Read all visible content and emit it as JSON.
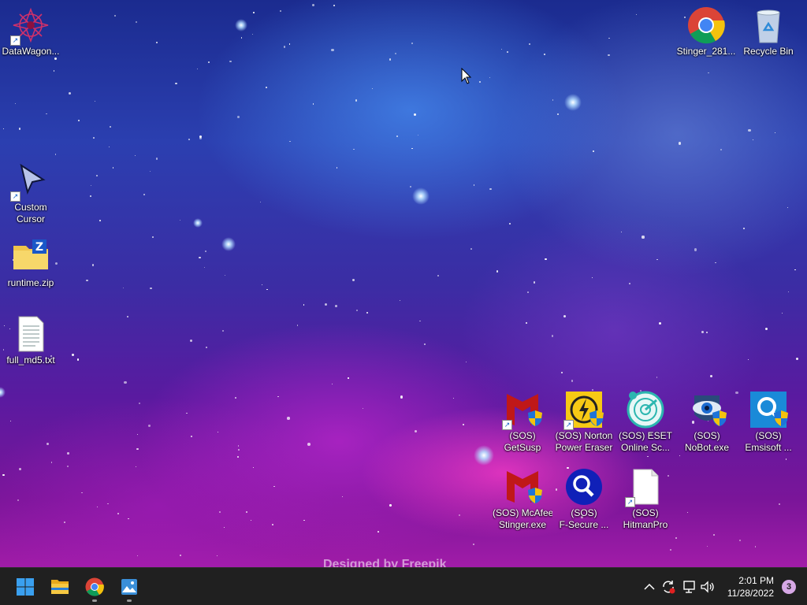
{
  "desktop": {
    "icons": [
      {
        "label": "DataWagon...",
        "icon": "datawagon-icon"
      },
      {
        "label": "Stinger_281...",
        "icon": "chrome-icon"
      },
      {
        "label": "Recycle Bin",
        "icon": "recycle-bin-icon"
      },
      {
        "label": "Custom\nCursor",
        "icon": "cursor-arrow-icon"
      },
      {
        "label": "runtime.zip",
        "icon": "zip-folder-icon"
      },
      {
        "label": "full_md5.txt",
        "icon": "text-file-icon"
      },
      {
        "label": "(SOS)\nGetSusp",
        "icon": "mcafee-icon"
      },
      {
        "label": "(SOS) Norton\nPower Eraser",
        "icon": "norton-icon"
      },
      {
        "label": "(SOS) ESET\nOnline Sc...",
        "icon": "eset-icon"
      },
      {
        "label": "(SOS)\nNoBot.exe",
        "icon": "nobot-eye-icon"
      },
      {
        "label": "(SOS)\nEmsisoft ...",
        "icon": "emsisoft-icon"
      },
      {
        "label": "(SOS) McAfee\nStinger.exe",
        "icon": "mcafee-icon"
      },
      {
        "label": "(SOS)\nF-Secure ...",
        "icon": "fsecure-magnifier-icon"
      },
      {
        "label": "(SOS)\nHitmanPro",
        "icon": "blank-file-icon"
      }
    ],
    "watermark": "Designed by Freepik"
  },
  "taskbar": {
    "apps": [
      {
        "name": "Start",
        "icon": "windows-start-icon"
      },
      {
        "name": "File Explorer",
        "icon": "folder-icon"
      },
      {
        "name": "Google Chrome",
        "icon": "chrome-icon"
      },
      {
        "name": "Photos",
        "icon": "photos-icon"
      }
    ],
    "tray": [
      "chevron-up-icon",
      "sync-icon",
      "network-icon",
      "volume-icon"
    ],
    "time": "2:01 PM",
    "date": "11/28/2022",
    "notification_count": "3"
  },
  "colors": {
    "taskbar_bg": "#202020",
    "windows_blue": "#3aa0f0",
    "chrome_red": "#db4437",
    "chrome_yellow": "#f4c20d",
    "chrome_green": "#0f9d58",
    "chrome_blue": "#4285f4",
    "notification_badge": "#d6a8e6"
  }
}
